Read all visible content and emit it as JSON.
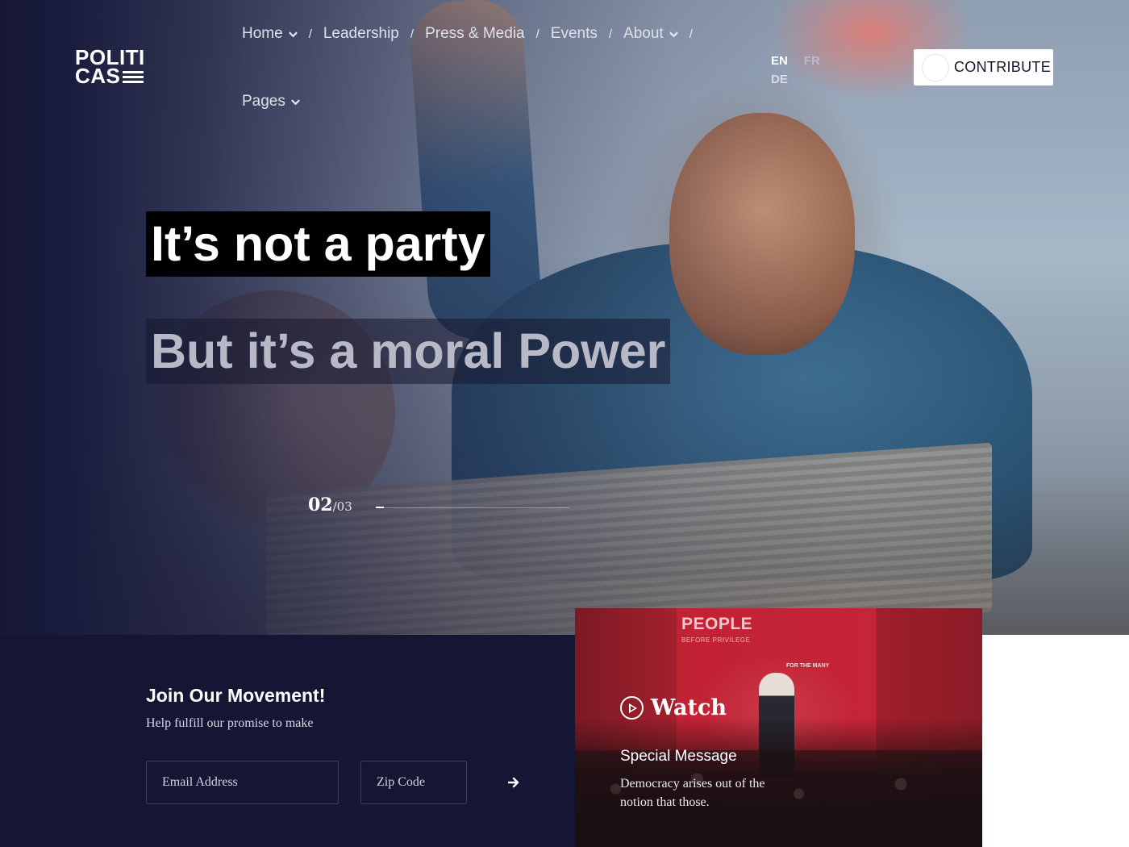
{
  "brand": {
    "logo_line1": "POLITI",
    "logo_line2": "CAS"
  },
  "nav": {
    "items": [
      {
        "label": "Home",
        "has_dropdown": true
      },
      {
        "label": "Leadership",
        "has_dropdown": false
      },
      {
        "label": "Press & Media",
        "has_dropdown": false
      },
      {
        "label": "Events",
        "has_dropdown": false
      },
      {
        "label": "About",
        "has_dropdown": true
      },
      {
        "label": "Pages",
        "has_dropdown": true
      }
    ],
    "separator": "/"
  },
  "languages": {
    "en": "EN",
    "fr": "FR",
    "de": "DE",
    "active": "EN"
  },
  "contribute": {
    "label": "CONTRIBUTE"
  },
  "hero": {
    "headline": "It’s not a party",
    "subheadline": "But it’s a moral Power",
    "slide_current": "02",
    "slide_total": "/03",
    "progress_fraction": 0.04
  },
  "signup": {
    "title": "Join Our Movement!",
    "subtitle": "Help fulfill our promise to make",
    "email_placeholder": "Email Address",
    "zip_placeholder": "Zip Code"
  },
  "video": {
    "watch_label": "Watch",
    "title": "Special Message",
    "description": "Democracy arises out of the notion that those.",
    "poster_text": "PEOPLE",
    "poster_subtext": "BEFORE PRIVILEGE",
    "poster_side_text": "FOR THE MANY"
  },
  "colors": {
    "page_bg": "#141633",
    "accent_video": "#c52536",
    "button_bg": "#ffffff"
  }
}
